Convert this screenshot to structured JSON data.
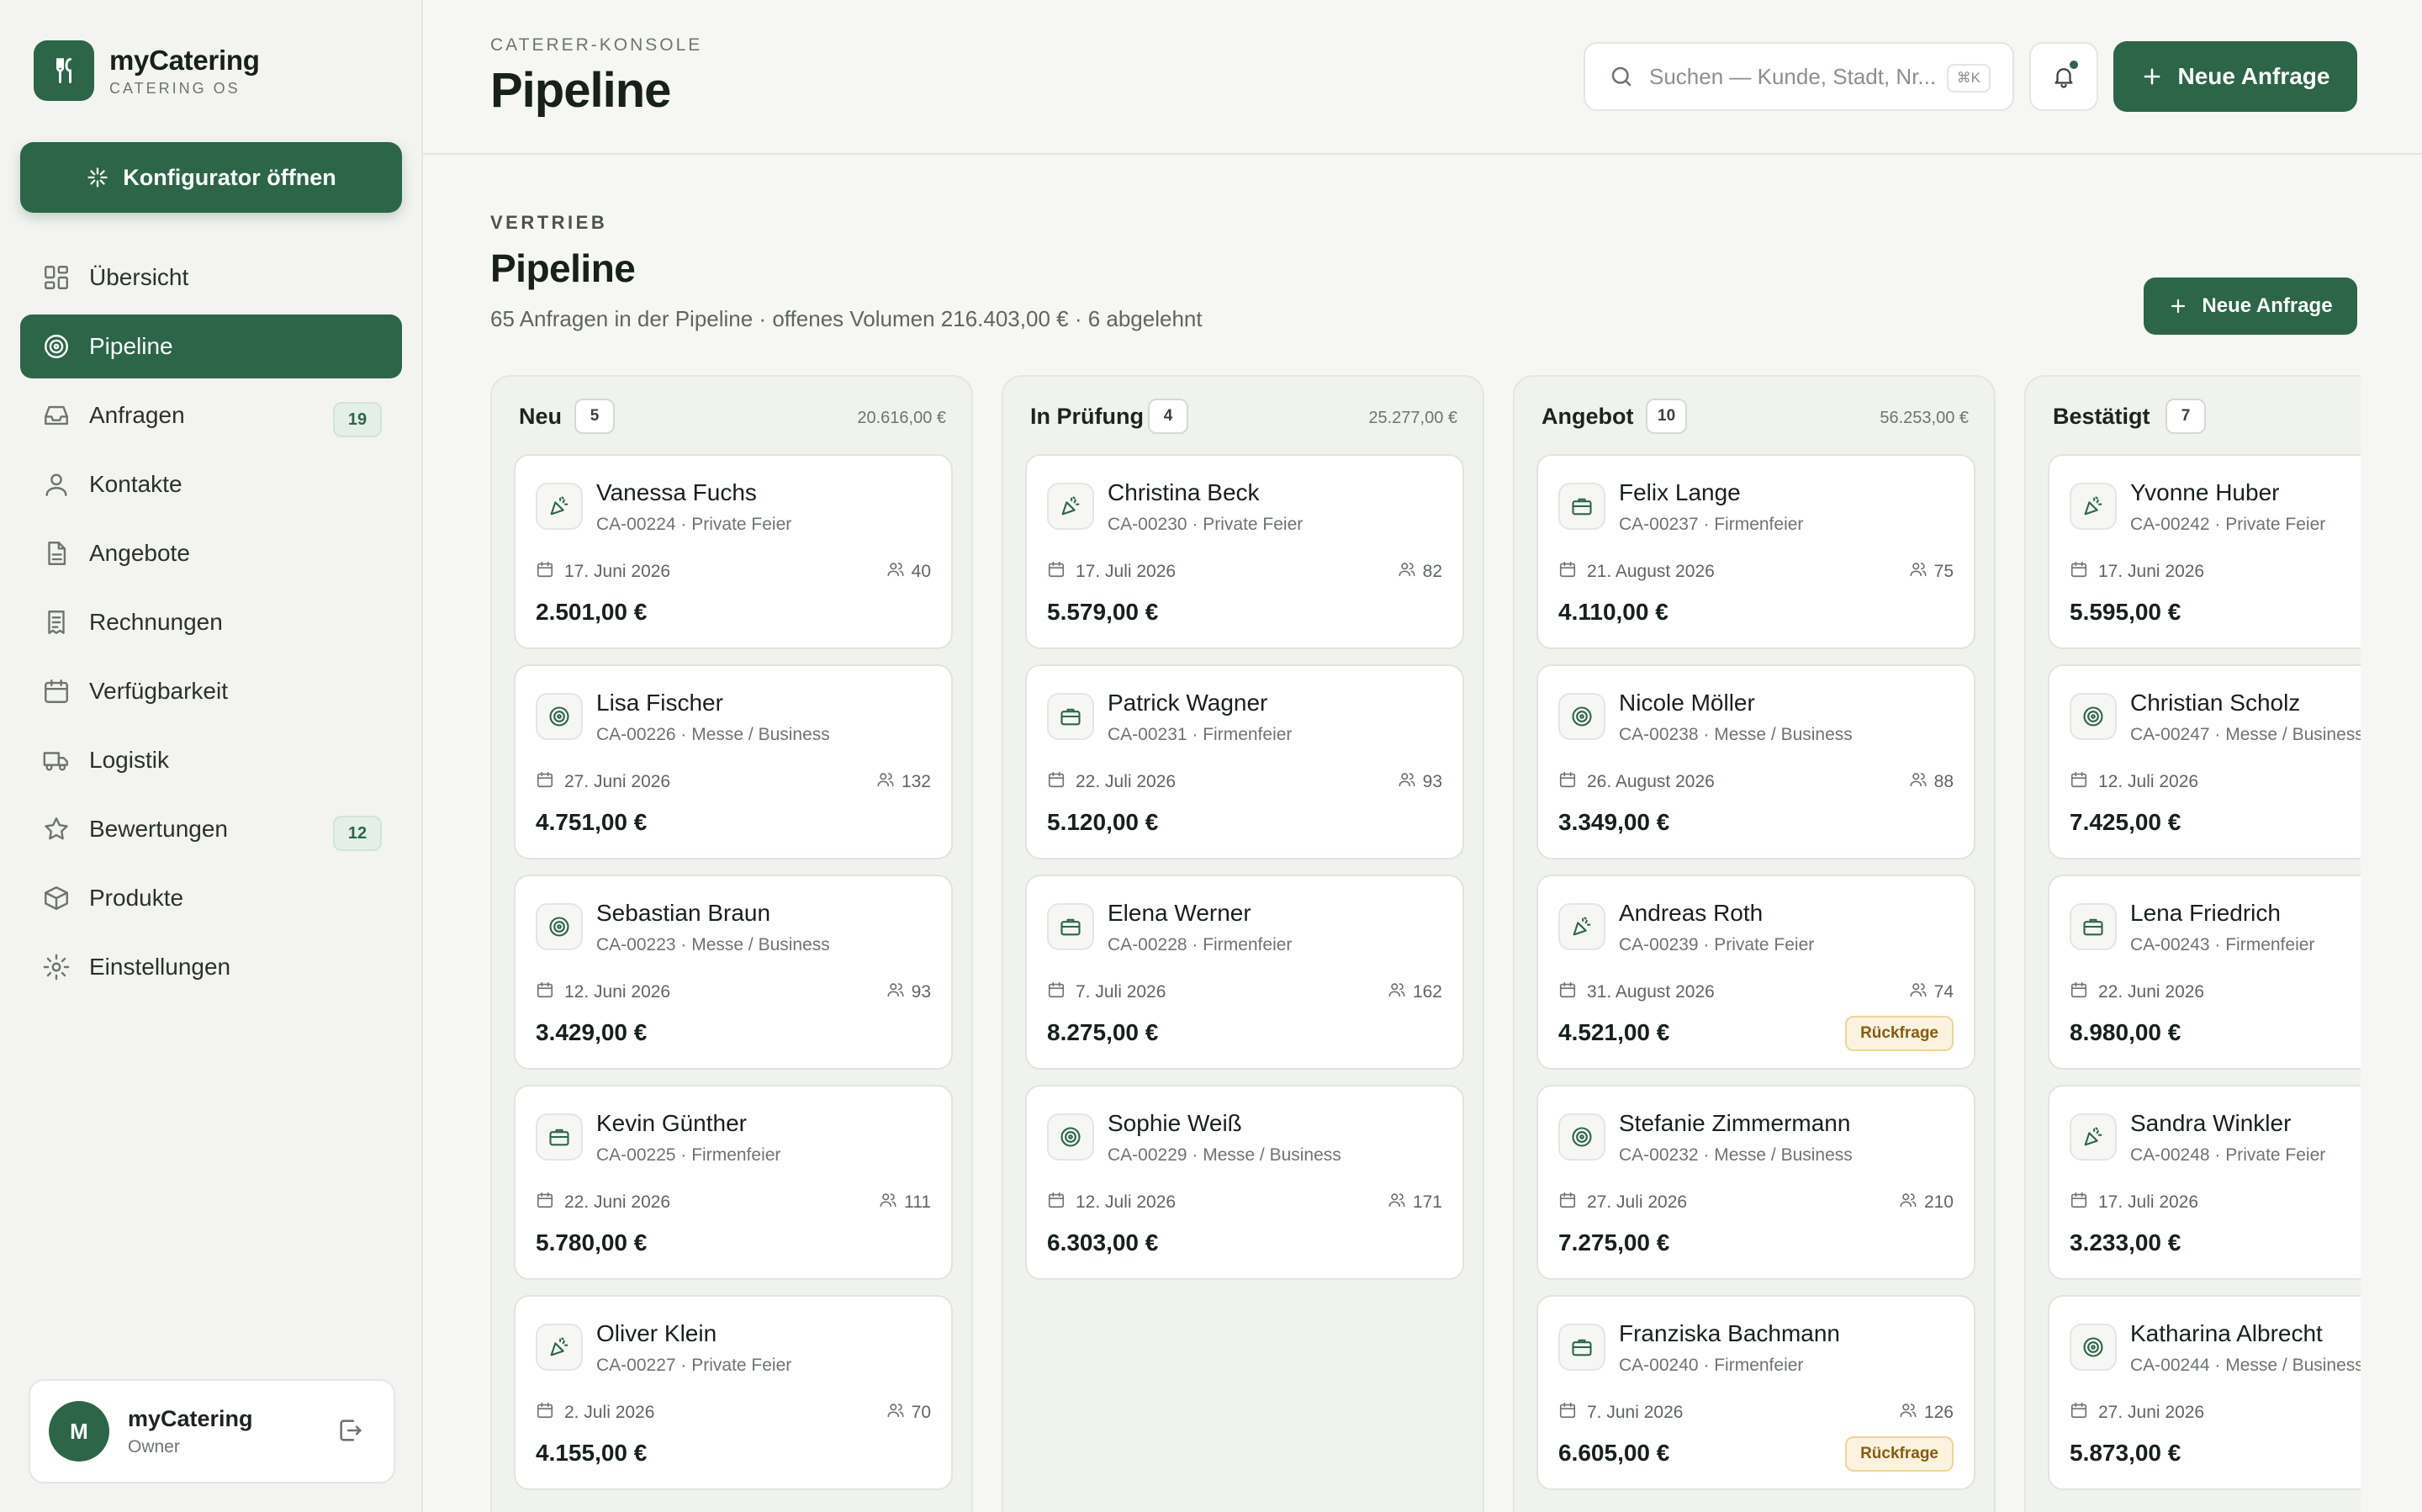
{
  "brand": {
    "name": "myCatering",
    "sub": "CATERING OS"
  },
  "sidebar": {
    "config_button": "Konfigurator öffnen",
    "items": [
      {
        "label": "Übersicht",
        "icon": "grid-icon",
        "active": false
      },
      {
        "label": "Pipeline",
        "icon": "target-icon",
        "active": true
      },
      {
        "label": "Anfragen",
        "icon": "inbox-icon",
        "active": false,
        "badge": "19"
      },
      {
        "label": "Kontakte",
        "icon": "user-icon",
        "active": false
      },
      {
        "label": "Angebote",
        "icon": "document-icon",
        "active": false
      },
      {
        "label": "Rechnungen",
        "icon": "receipt-icon",
        "active": false
      },
      {
        "label": "Verfügbarkeit",
        "icon": "calendar-icon",
        "active": false
      },
      {
        "label": "Logistik",
        "icon": "truck-icon",
        "active": false
      },
      {
        "label": "Bewertungen",
        "icon": "star-icon",
        "active": false,
        "badge": "12"
      },
      {
        "label": "Produkte",
        "icon": "box-icon",
        "active": false
      },
      {
        "label": "Einstellungen",
        "icon": "gear-icon",
        "active": false
      }
    ],
    "user": {
      "initial": "M",
      "name": "myCatering",
      "role": "Owner"
    }
  },
  "header": {
    "kicker": "CATERER-KONSOLE",
    "title": "Pipeline",
    "search_placeholder": "Suchen — Kunde, Stadt, Nr...",
    "search_shortcut": "⌘K",
    "new_button": "Neue Anfrage"
  },
  "section": {
    "kicker": "VERTRIEB",
    "title": "Pipeline",
    "subtitle": "65 Anfragen in der Pipeline · offenes Volumen 216.403,00 € · 6 abgelehnt",
    "new_button": "Neue Anfrage"
  },
  "colors": {
    "accent": "#2c6548",
    "flag_bg": "#fbf3df",
    "flag_text": "#8a5a0b"
  },
  "columns": [
    {
      "title": "Neu",
      "count": "5",
      "sum": "20.616,00 €",
      "cards": [
        {
          "name": "Vanessa Fuchs",
          "meta": "CA-00224 · Private Feier",
          "icon": "party-icon",
          "date": "17. Juni 2026",
          "guests": "40",
          "price": "2.501,00 €"
        },
        {
          "name": "Lisa Fischer",
          "meta": "CA-00226 · Messe / Business",
          "icon": "target-icon",
          "date": "27. Juni 2026",
          "guests": "132",
          "price": "4.751,00 €"
        },
        {
          "name": "Sebastian Braun",
          "meta": "CA-00223 · Messe / Business",
          "icon": "target-icon",
          "date": "12. Juni 2026",
          "guests": "93",
          "price": "3.429,00 €"
        },
        {
          "name": "Kevin Günther",
          "meta": "CA-00225 · Firmenfeier",
          "icon": "briefcase-icon",
          "date": "22. Juni 2026",
          "guests": "111",
          "price": "5.780,00 €"
        },
        {
          "name": "Oliver Klein",
          "meta": "CA-00227 · Private Feier",
          "icon": "party-icon",
          "date": "2. Juli 2026",
          "guests": "70",
          "price": "4.155,00 €"
        }
      ]
    },
    {
      "title": "In Prüfung",
      "count": "4",
      "sum": "25.277,00 €",
      "cards": [
        {
          "name": "Christina Beck",
          "meta": "CA-00230 · Private Feier",
          "icon": "party-icon",
          "date": "17. Juli 2026",
          "guests": "82",
          "price": "5.579,00 €"
        },
        {
          "name": "Patrick Wagner",
          "meta": "CA-00231 · Firmenfeier",
          "icon": "briefcase-icon",
          "date": "22. Juli 2026",
          "guests": "93",
          "price": "5.120,00 €"
        },
        {
          "name": "Elena Werner",
          "meta": "CA-00228 · Firmenfeier",
          "icon": "briefcase-icon",
          "date": "7. Juli 2026",
          "guests": "162",
          "price": "8.275,00 €"
        },
        {
          "name": "Sophie Weiß",
          "meta": "CA-00229 · Messe / Business",
          "icon": "target-icon",
          "date": "12. Juli 2026",
          "guests": "171",
          "price": "6.303,00 €"
        }
      ]
    },
    {
      "title": "Angebot",
      "count": "10",
      "sum": "56.253,00 €",
      "cards": [
        {
          "name": "Felix Lange",
          "meta": "CA-00237 · Firmenfeier",
          "icon": "briefcase-icon",
          "date": "21. August 2026",
          "guests": "75",
          "price": "4.110,00 €"
        },
        {
          "name": "Nicole Möller",
          "meta": "CA-00238 · Messe / Business",
          "icon": "target-icon",
          "date": "26. August 2026",
          "guests": "88",
          "price": "3.349,00 €"
        },
        {
          "name": "Andreas Roth",
          "meta": "CA-00239 · Private Feier",
          "icon": "party-icon",
          "date": "31. August 2026",
          "guests": "74",
          "price": "4.521,00 €",
          "flag": "Rückfrage"
        },
        {
          "name": "Stefanie Zimmermann",
          "meta": "CA-00232 · Messe / Business",
          "icon": "target-icon",
          "date": "27. Juli 2026",
          "guests": "210",
          "price": "7.275,00 €"
        },
        {
          "name": "Franziska Bachmann",
          "meta": "CA-00240 · Firmenfeier",
          "icon": "briefcase-icon",
          "date": "7. Juni 2026",
          "guests": "126",
          "price": "6.605,00 €",
          "flag": "Rückfrage"
        }
      ]
    },
    {
      "title": "Bestätigt",
      "count": "7",
      "sum": "",
      "cards": [
        {
          "name": "Yvonne Huber",
          "meta": "CA-00242 · Private Feier",
          "icon": "party-icon",
          "date": "17. Juni 2026",
          "guests": "",
          "price": "5.595,00 €"
        },
        {
          "name": "Christian Scholz",
          "meta": "CA-00247 · Messe / Business",
          "icon": "target-icon",
          "date": "12. Juli 2026",
          "guests": "",
          "price": "7.425,00 €"
        },
        {
          "name": "Lena Friedrich",
          "meta": "CA-00243 · Firmenfeier",
          "icon": "briefcase-icon",
          "date": "22. Juni 2026",
          "guests": "",
          "price": "8.980,00 €"
        },
        {
          "name": "Sandra Winkler",
          "meta": "CA-00248 · Private Feier",
          "icon": "party-icon",
          "date": "17. Juli 2026",
          "guests": "",
          "price": "3.233,00 €"
        },
        {
          "name": "Katharina Albrecht",
          "meta": "CA-00244 · Messe / Business",
          "icon": "target-icon",
          "date": "27. Juni 2026",
          "guests": "",
          "price": "5.873,00 €"
        }
      ]
    }
  ]
}
